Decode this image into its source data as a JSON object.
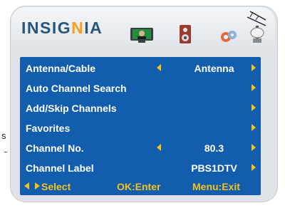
{
  "brand": {
    "name_left": "INSIG",
    "name_mid": "N",
    "name_right": "IA"
  },
  "category_icons": [
    "tv-icon",
    "speaker-icon",
    "settings-icon",
    "antenna-icon"
  ],
  "menu": {
    "items": [
      {
        "label": "Antenna/Cable",
        "value": "Antenna",
        "left_arrow": true,
        "right_arrow": true
      },
      {
        "label": "Auto Channel Search",
        "value": "",
        "left_arrow": false,
        "right_arrow": true
      },
      {
        "label": "Add/Skip Channels",
        "value": "",
        "left_arrow": false,
        "right_arrow": true
      },
      {
        "label": "Favorites",
        "value": "",
        "left_arrow": false,
        "right_arrow": true
      },
      {
        "label": "Channel No.",
        "value": "80.3",
        "left_arrow": true,
        "right_arrow": true
      },
      {
        "label": "Channel Label",
        "value": "PBS1DTV",
        "left_arrow": false,
        "right_arrow": true
      }
    ]
  },
  "help": {
    "select": "Select",
    "enter": "OK:Enter",
    "exit": "Menu:Exit"
  },
  "side_text": "s",
  "colors": {
    "panel": "#135dae",
    "accent": "#f4c31a",
    "brand": "#27567d",
    "brand_dot": "#f6a01a",
    "frame": "#dfe3e8"
  }
}
